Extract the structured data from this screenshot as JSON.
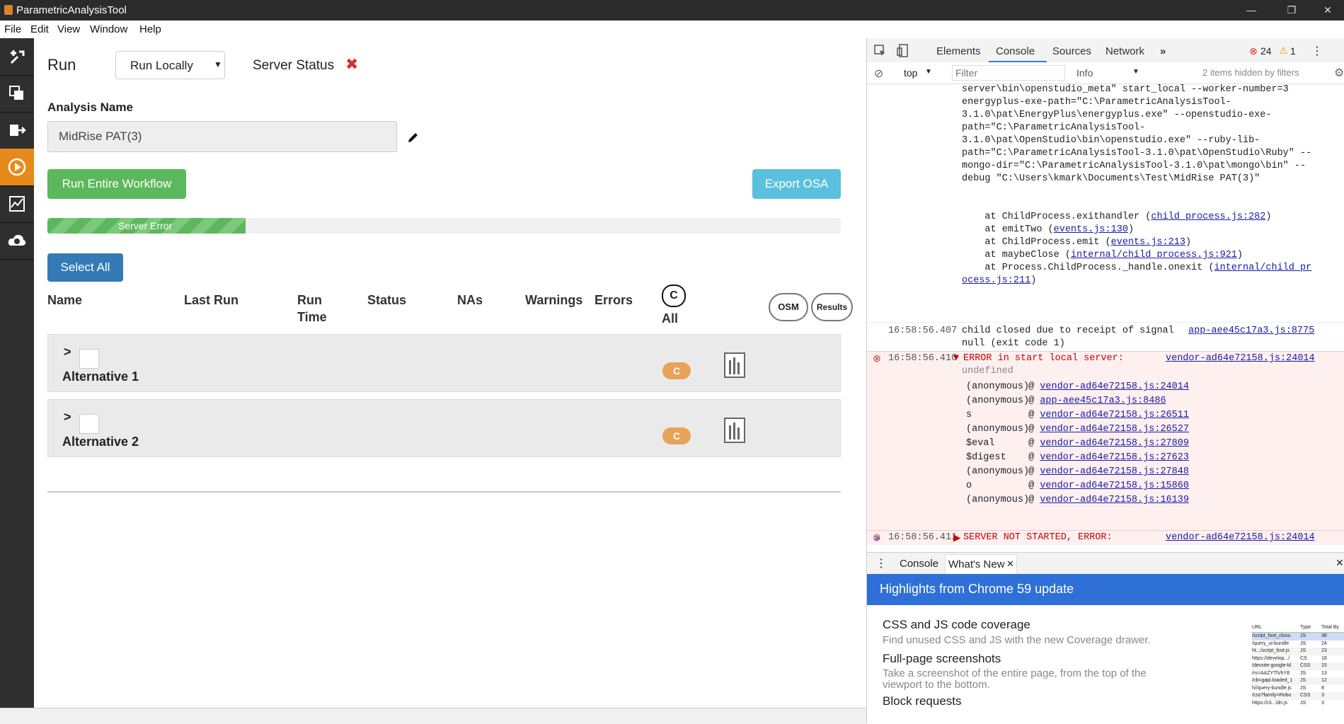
{
  "window": {
    "title": "ParametricAnalysisTool",
    "controls": [
      "—",
      "❐",
      "✕"
    ]
  },
  "menu": [
    "File",
    "Edit",
    "View",
    "Window",
    "Help"
  ],
  "sidebar": {
    "items": [
      {
        "icon": "tools-icon"
      },
      {
        "icon": "layers-icon"
      },
      {
        "icon": "export-icon"
      },
      {
        "icon": "play-icon",
        "active": true
      },
      {
        "icon": "chart-icon"
      },
      {
        "icon": "cloud-os-icon"
      }
    ]
  },
  "run": {
    "title": "Run",
    "mode_select": "Run Locally",
    "server_status_label": "Server Status",
    "server_status_icon": "✖",
    "analysis_name_label": "Analysis Name",
    "analysis_name_value": "MidRise PAT(3)",
    "run_button": "Run Entire Workflow",
    "export_button": "Export OSA",
    "progress_label": "Server Error",
    "progress_fraction": 0.25,
    "select_all": "Select All",
    "columns": {
      "name": "Name",
      "last_run": "Last Run",
      "run_time_1": "Run",
      "run_time_2": "Time",
      "status": "Status",
      "nas": "NAs",
      "warnings": "Warnings",
      "errors": "Errors",
      "c_all_badge": "C",
      "c_all_label": "All",
      "osm": "OSM",
      "results": "Results"
    },
    "alternatives": [
      {
        "name": "Alternative 1",
        "badge": "C"
      },
      {
        "name": "Alternative 2",
        "badge": "C"
      }
    ]
  },
  "devtools": {
    "tabs": [
      "Elements",
      "Console",
      "Sources",
      "Network",
      "»"
    ],
    "active_tab": "Console",
    "error_count": "24",
    "warning_count": "1",
    "context": "top",
    "filter_placeholder": "Filter",
    "level": "Info",
    "hidden_note": "2 items hidden by filters",
    "console_lines": [
      "server\\bin\\openstudio_meta\" start_local --worker-number=3",
      "energyplus-exe-path=\"C:\\ParametricAnalysisTool-",
      "3.1.0\\pat\\EnergyPlus\\energyplus.exe\" --openstudio-exe-",
      "path=\"C:\\ParametricAnalysisTool-",
      "3.1.0\\pat\\OpenStudio\\bin\\openstudio.exe\" --ruby-lib-",
      "path=\"C:\\ParametricAnalysisTool-3.1.0\\pat\\OpenStudio\\Ruby\" --",
      "mongo-dir=\"C:\\ParametricAnalysisTool-3.1.0\\pat\\mongo\\bin\" --",
      "debug \"C:\\Users\\kmark\\Documents\\Test\\MidRise PAT(3)\""
    ],
    "stack": [
      {
        "pre": "    at ChildProcess.exithandler (",
        "link": "child_process.js:282",
        "post": ")"
      },
      {
        "pre": "    at emitTwo (",
        "link": "events.js:130",
        "post": ")"
      },
      {
        "pre": "    at ChildProcess.emit (",
        "link": "events.js:213",
        "post": ")"
      },
      {
        "pre": "    at maybeClose (",
        "link": "internal/child_process.js:921",
        "post": ")"
      },
      {
        "pre": "    at Process.ChildProcess._handle.onexit (",
        "link": "internal/child_pr",
        "post": ""
      },
      {
        "pre": "",
        "link": "ocess.js:211",
        "post": ")"
      }
    ],
    "msg1": {
      "ts": "16:58:56.407",
      "text1": "child closed due to receipt of signal",
      "text2": "null (exit code 1)",
      "src": "app-aee45c17a3.js:8775"
    },
    "msg2": {
      "ts": "16:58:56.410",
      "text1": "ERROR in start local server:",
      "text2": "undefined",
      "src": "vendor-ad64e72158.js:24014",
      "trace": [
        {
          "fn": "(anonymous)",
          "src": "vendor-ad64e72158.js:24014"
        },
        {
          "fn": "(anonymous)",
          "src": "app-aee45c17a3.js:8486"
        },
        {
          "fn": "s",
          "src": "vendor-ad64e72158.js:26511"
        },
        {
          "fn": "(anonymous)",
          "src": "vendor-ad64e72158.js:26527"
        },
        {
          "fn": "$eval",
          "src": "vendor-ad64e72158.js:27809"
        },
        {
          "fn": "$digest",
          "src": "vendor-ad64e72158.js:27623"
        },
        {
          "fn": "(anonymous)",
          "src": "vendor-ad64e72158.js:27848"
        },
        {
          "fn": "o",
          "src": "vendor-ad64e72158.js:15860"
        },
        {
          "fn": "(anonymous)",
          "src": "vendor-ad64e72158.js:16139"
        }
      ]
    },
    "msg3": {
      "ts": "16:58:56.411",
      "text1": "SERVER NOT STARTED, ERROR:",
      "text2": "undefined",
      "src": "vendor-ad64e72158.js:24014"
    },
    "prompt": ">",
    "drawer": {
      "tabs": [
        "Console",
        "What's New"
      ],
      "banner": "Highlights from Chrome 59 update",
      "items": [
        {
          "title": "CSS and JS code coverage",
          "desc": "Find unused CSS and JS with the new Coverage drawer."
        },
        {
          "title": "Full-page screenshots",
          "desc": "Take a screenshot of the entire page, from the top of the viewport to the bottom."
        },
        {
          "title": "Block requests",
          "desc": ""
        }
      ],
      "thumb_header": [
        "URL",
        "Type",
        "Total By"
      ],
      "thumb_rows": [
        [
          "/script_foot_closu",
          "JS",
          "38"
        ],
        [
          "/query_ui-bundle",
          "JS",
          "24"
        ],
        [
          "ht.../script_foot.js",
          "JS",
          "23"
        ],
        [
          "https://develop.../",
          "CS",
          "18"
        ],
        [
          "/devsite-google-bl",
          "CSS",
          "15"
        ],
        [
          "/rs=AAZYTlVhYE",
          "JS",
          "13"
        ],
        [
          "/cb=gapi.loaded_1",
          "JS",
          "12"
        ],
        [
          "h//query-bundle.js",
          "JS",
          "8"
        ],
        [
          "/css?family=Robo",
          "CSS",
          "3"
        ],
        [
          "https://cli.../dn.js",
          "JS",
          "3"
        ]
      ]
    }
  },
  "colors": {
    "accent_orange": "#e78a1c",
    "green": "#5cb85c",
    "blue": "#337ab7",
    "lightblue": "#5bc0de",
    "error_red": "#d9302a",
    "chrome_blue": "#2f6fd8"
  }
}
